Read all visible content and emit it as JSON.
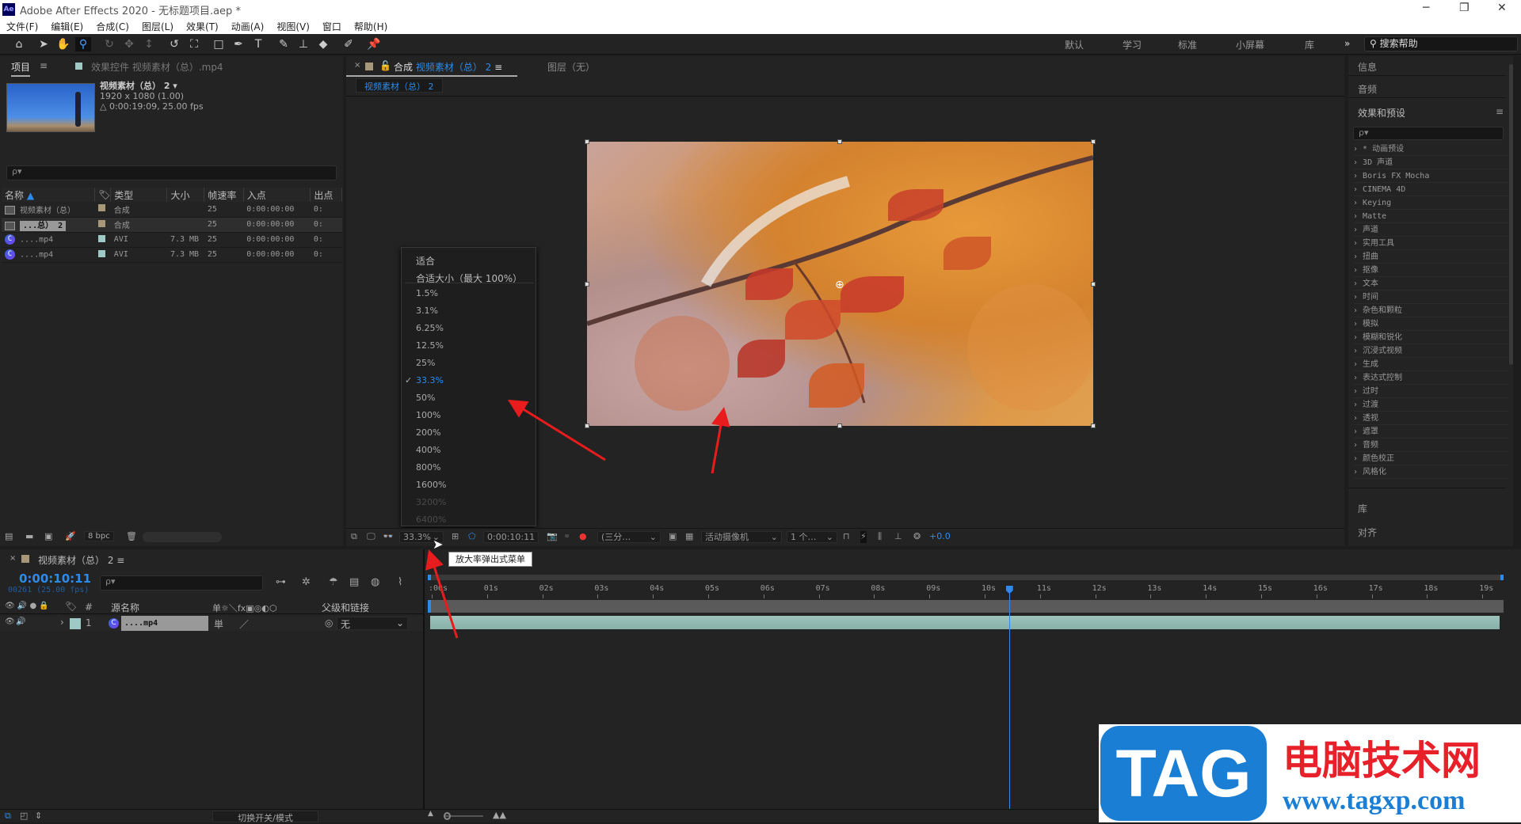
{
  "window": {
    "app_icon": "Ae",
    "title": "Adobe After Effects 2020 - 无标题项目.aep *"
  },
  "menu": [
    "文件(F)",
    "编辑(E)",
    "合成(C)",
    "图层(L)",
    "效果(T)",
    "动画(A)",
    "视图(V)",
    "窗口",
    "帮助(H)"
  ],
  "workspaces": [
    "默认",
    "学习",
    "标准",
    "小屏幕",
    "库"
  ],
  "workspace_more": "»",
  "help_search": "搜索帮助",
  "project": {
    "tab": "项目",
    "effects_tab": "效果控件 视频素材（总）.mp4",
    "item_name": "视频素材（总） 2 ▾",
    "item_size": "1920 x 1080 (1.00)",
    "item_duration": "△ 0:00:19:09, 25.00 fps",
    "search_placeholder": "ρ▾",
    "columns": [
      "名称",
      "类型",
      "大小",
      "帧速率",
      "入点",
      "出点"
    ],
    "rows": [
      {
        "name": "视频素材（总）",
        "type": "合成",
        "size": "",
        "fps": "25",
        "in": "0:00:00:00",
        "out": "0:",
        "label_color": "#a8987a",
        "icon": "composition-icon"
      },
      {
        "name": "...总） 2",
        "type": "合成",
        "size": "",
        "fps": "25",
        "in": "0:00:00:00",
        "out": "0:",
        "label_color": "#a8987a",
        "icon": "composition-icon",
        "selected": true
      },
      {
        "name": "....mp4",
        "type": "AVI",
        "size": "7.3 MB",
        "fps": "25",
        "in": "0:00:00:00",
        "out": "0:",
        "label_color": "#9fc9c4",
        "icon": "footage-icon"
      },
      {
        "name": "....mp4",
        "type": "AVI",
        "size": "7.3 MB",
        "fps": "25",
        "in": "0:00:00:00",
        "out": "0:",
        "label_color": "#9fc9c4",
        "icon": "footage-icon"
      }
    ],
    "bpc": "8 bpc"
  },
  "viewer": {
    "tab_prefix": "合成",
    "comp_name": "视频素材（总） 2",
    "layer_tab": "图层（无）",
    "breadcrumb": "视频素材（总） 2",
    "zoom": "33.3%",
    "timecode": "0:00:10:11",
    "resolution": "(三分…",
    "camera": "活动摄像机",
    "views": "1 个…",
    "exposure": "+0.0",
    "tooltip": "放大率弹出式菜单"
  },
  "zoom_menu": {
    "fit": "适合",
    "fit_max": "合适大小（最大 100%）",
    "options": [
      "1.5%",
      "3.1%",
      "6.25%",
      "12.5%",
      "25%",
      "33.3%",
      "50%",
      "100%",
      "200%",
      "400%",
      "800%",
      "1600%",
      "3200%",
      "6400%"
    ],
    "selected": "33.3%",
    "disabled": [
      "3200%",
      "6400%"
    ]
  },
  "right_panel": {
    "info": "信息",
    "audio": "音频",
    "effects": "效果和预设",
    "search_placeholder": "ρ▾",
    "library": "库",
    "align": "对齐",
    "categories": [
      "* 动画预设",
      "3D 声道",
      "Boris FX Mocha",
      "CINEMA 4D",
      "Keying",
      "Matte",
      "声道",
      "实用工具",
      "扭曲",
      "抠像",
      "文本",
      "时间",
      "杂色和颗粒",
      "模拟",
      "模糊和锐化",
      "沉浸式视频",
      "生成",
      "表达式控制",
      "过时",
      "过渡",
      "透视",
      "遮罩",
      "音频",
      "颜色校正",
      "风格化"
    ]
  },
  "timeline": {
    "tab": "视频素材（总） 2",
    "timecode": "0:00:10:11",
    "frame_info": "00261 (25.00 fps)",
    "search_placeholder": "ρ▾",
    "col_num": "#",
    "col_source": "源名称",
    "col_parent": "父级和链接",
    "col_switches": "单☼＼fx▣◎◐⬡",
    "ruler": [
      ":00s",
      "01s",
      "02s",
      "03s",
      "04s",
      "05s",
      "06s",
      "07s",
      "08s",
      "09s",
      "10s",
      "11s",
      "12s",
      "13s",
      "14s",
      "15s",
      "16s",
      "17s",
      "18s",
      "19s"
    ],
    "playhead_seconds": 10.44,
    "layer": {
      "index": "1",
      "name": "....mp4",
      "parent": "无",
      "label_color": "#9fc9c4"
    },
    "toggle_label": "切换开关/模式"
  },
  "watermark": {
    "logo": "TAG",
    "site_name": "电脑技术网",
    "url": "www.tagxp.com"
  },
  "colors": {
    "accent": "#2d8ceb",
    "annotation": "#e81c1c"
  }
}
